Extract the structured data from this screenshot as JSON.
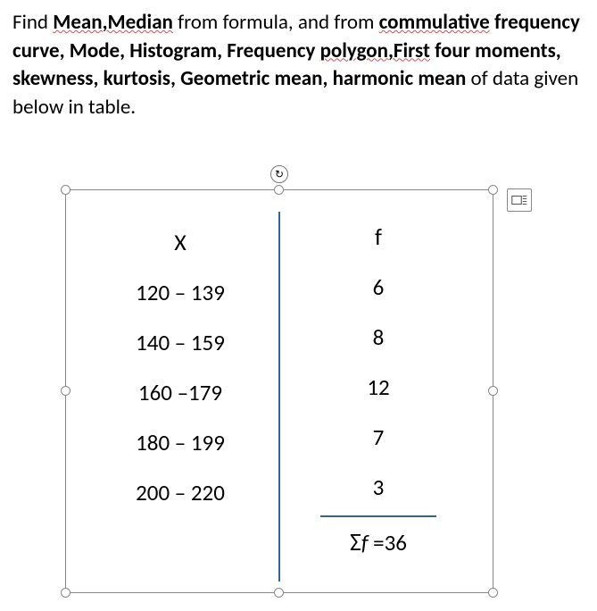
{
  "question": {
    "parts": [
      {
        "text": "Find ",
        "sq": false
      },
      {
        "text": "Mean,Median",
        "sq": true,
        "bold": true
      },
      {
        "text": " from formula, and from ",
        "sq": false
      },
      {
        "text": "commulative",
        "sq": true,
        "bold": true
      },
      {
        "text": " ",
        "sq": false
      },
      {
        "text": "frequency curve, Mode, Histogram, Frequency ",
        "sq": false,
        "bold": true
      },
      {
        "text": "polygon,First",
        "sq": true,
        "bold": true
      },
      {
        "text": " four moments, skewness, kurtosis, Geometric mean, harmonic mean",
        "sq": false,
        "bold": true
      },
      {
        "text": " of data given below in table.",
        "sq": false
      }
    ]
  },
  "table": {
    "header_x": "X",
    "header_f": "f",
    "rows": [
      {
        "x": "120 – 139",
        "f": "6"
      },
      {
        "x": "140 – 159",
        "f": "8"
      },
      {
        "x": "160 –179",
        "f": "12"
      },
      {
        "x": "180 – 199",
        "f": "7"
      },
      {
        "x": "200 – 220",
        "f": "3"
      }
    ],
    "sum_label": "Σ",
    "sum_var": "f",
    "sum_eq": " =36"
  },
  "chart_data": {
    "type": "table",
    "columns": [
      "X",
      "f"
    ],
    "rows": [
      [
        "120 – 139",
        6
      ],
      [
        "140 – 159",
        8
      ],
      [
        "160 –179",
        12
      ],
      [
        "180 – 199",
        7
      ],
      [
        "200 – 220",
        3
      ]
    ],
    "sum_f": 36
  }
}
